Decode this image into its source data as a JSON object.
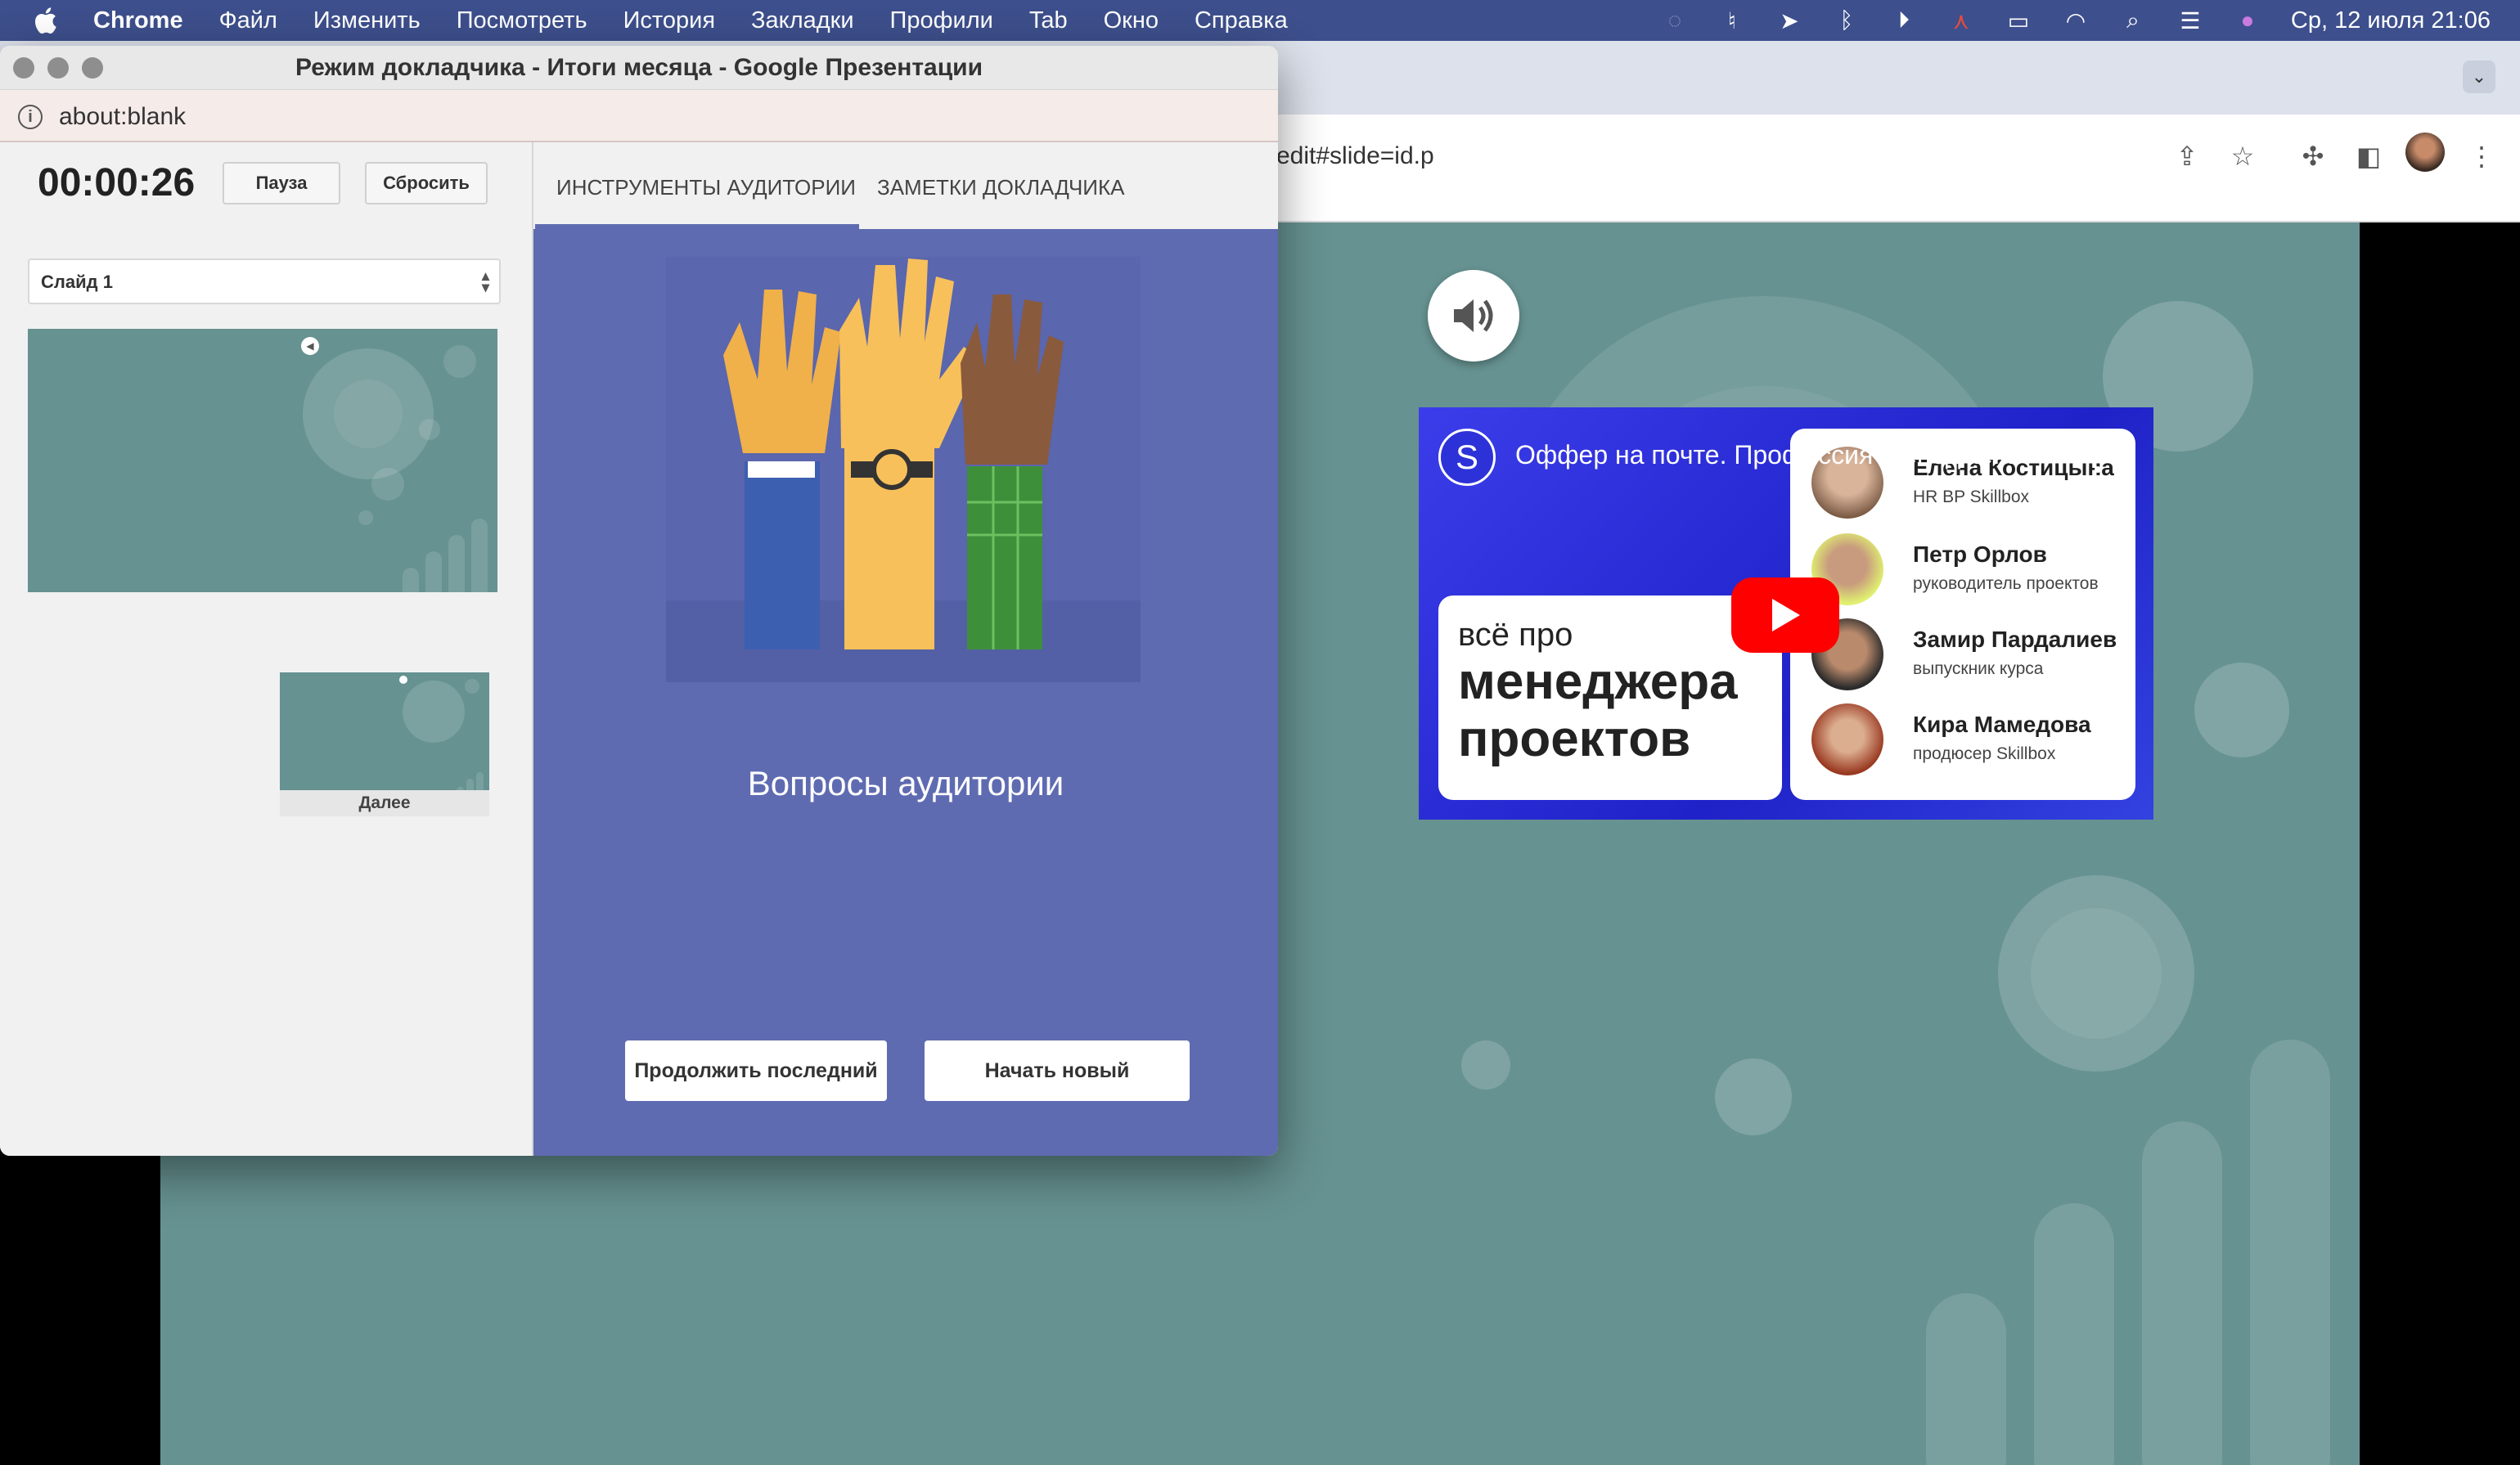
{
  "menubar": {
    "app": "Chrome",
    "items": [
      "Файл",
      "Изменить",
      "Посмотреть",
      "История",
      "Закладки",
      "Профили",
      "Tab",
      "Окно",
      "Справка"
    ],
    "clock": "Ср, 12 июля  21:06"
  },
  "browser": {
    "url_fragment": "edit#slide=id.p"
  },
  "video": {
    "channel_initial": "S",
    "title": "Оффер на почте. Профессия Менедже...",
    "card_line1": "всё про",
    "card_line2": "менеджера",
    "card_line3": "проектов",
    "people": [
      {
        "name": "Елена Костицына",
        "role": "HR BP Skillbox"
      },
      {
        "name": "Петр Орлов",
        "role": "руководитель проектов"
      },
      {
        "name": "Замир Пардалиев",
        "role": "выпускник курса"
      },
      {
        "name": "Кира Мамедова",
        "role": "продюсер Skillbox"
      }
    ]
  },
  "presenter": {
    "window_title": "Режим докладчика - Итоги месяца - Google Презентации",
    "url": "about:blank",
    "timer": "00:00:26",
    "pause_label": "Пауза",
    "reset_label": "Сбросить",
    "slide_select": "Слайд 1",
    "next_label": "Далее",
    "tabs": [
      "ИНСТРУМЕНТЫ АУДИТОРИИ",
      "ЗАМЕТКИ ДОКЛАДЧИКА"
    ],
    "qa_title": "Вопросы аудитории",
    "continue_label": "Продолжить последний",
    "new_label": "Начать новый"
  },
  "colors": {
    "menubar": "#3d4f8c",
    "slide_bg": "#669291",
    "audience_panel": "#5f6bb1",
    "youtube_red": "#ff0000"
  }
}
